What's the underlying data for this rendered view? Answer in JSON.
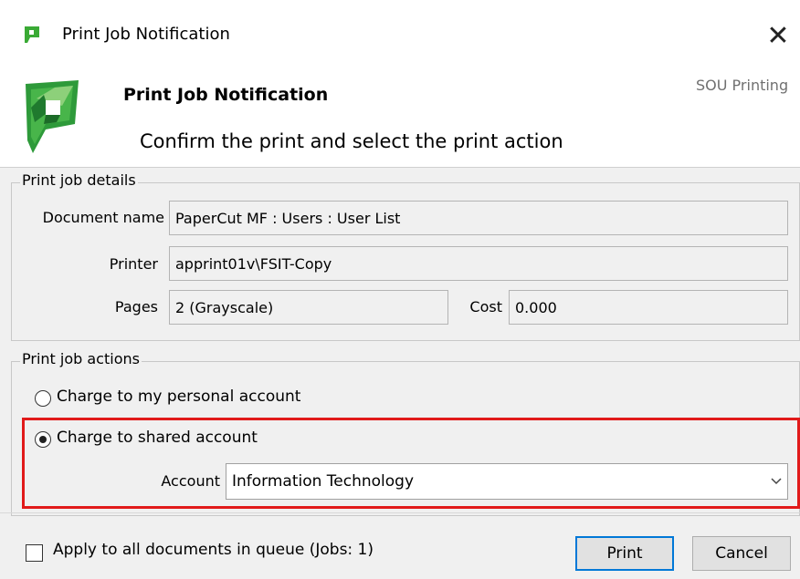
{
  "window": {
    "title": "Print Job Notification"
  },
  "header": {
    "title": "Print Job Notification",
    "brand": "SOU Printing",
    "subtitle": "Confirm the print and select the print action"
  },
  "details": {
    "group_label": "Print job details",
    "document_name_label": "Document name",
    "document_name_value": "PaperCut MF : Users : User List",
    "printer_label": "Printer",
    "printer_value": "apprint01v\\FSIT-Copy",
    "pages_label": "Pages",
    "pages_value": "2  (Grayscale)",
    "cost_label": "Cost",
    "cost_value": "0.000"
  },
  "actions": {
    "group_label": "Print job actions",
    "personal_label": "Charge to my personal account",
    "shared_label": "Charge to shared account",
    "selected": "shared",
    "account_label": "Account",
    "account_value": "Information Technology"
  },
  "footer": {
    "apply_label": "Apply to all documents in queue (Jobs: 1)",
    "print_label": "Print",
    "cancel_label": "Cancel"
  },
  "colors": {
    "logo_green": "#3aaa35",
    "logo_dark": "#1f7a2e",
    "highlight": "#e11a1a",
    "default_button_border": "#0078d7"
  },
  "icons": {
    "title": "papercut-logo-icon",
    "close": "close-icon",
    "dropdown": "chevron-down-icon"
  }
}
